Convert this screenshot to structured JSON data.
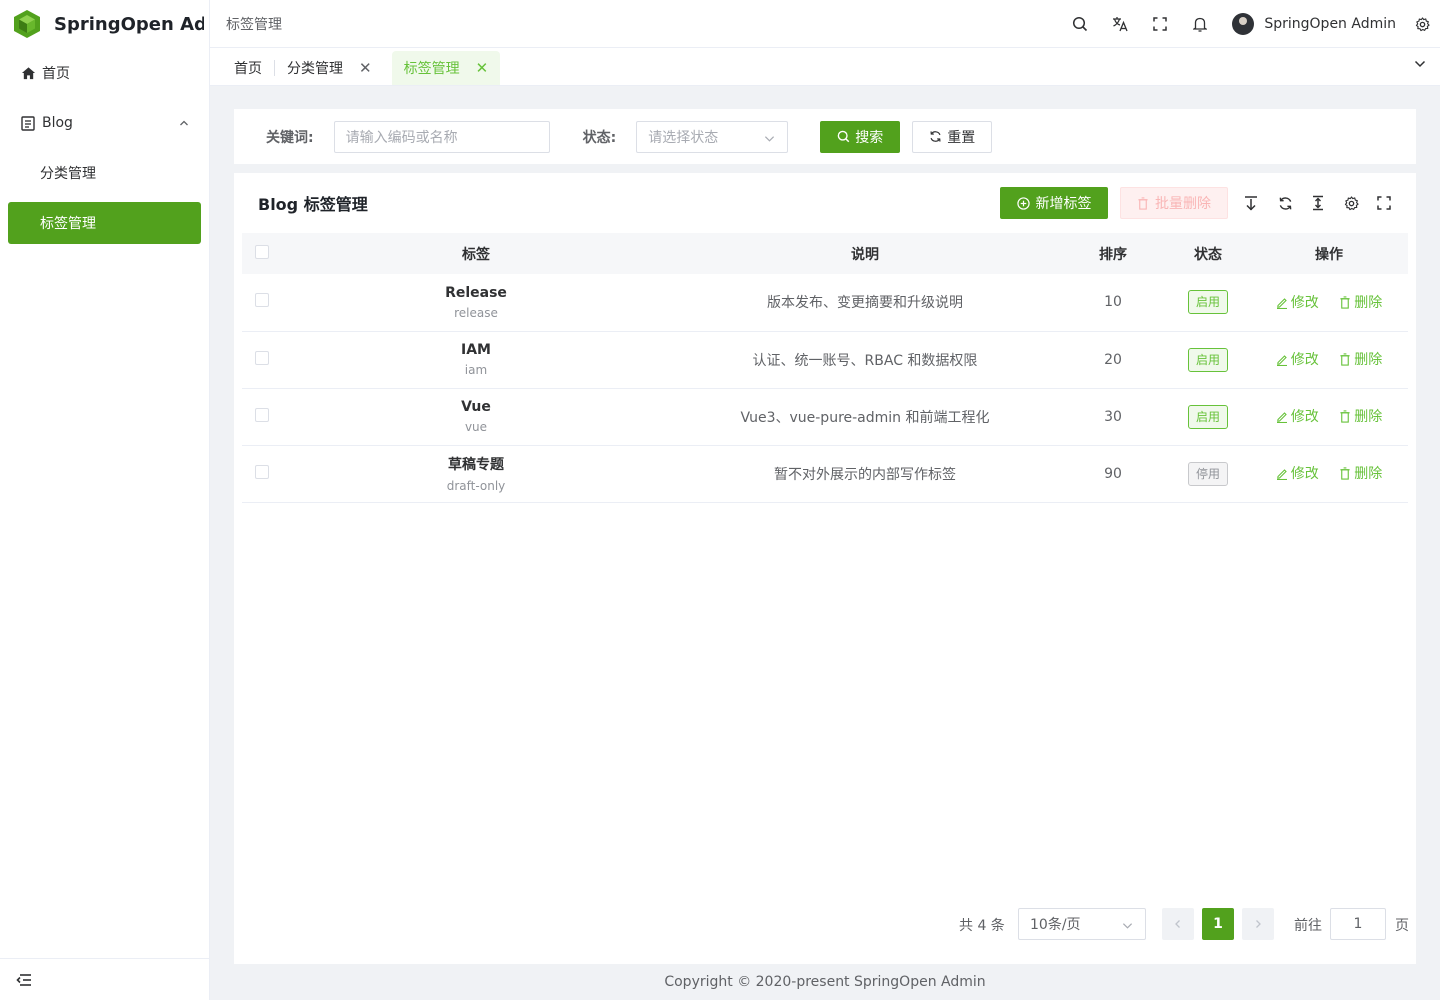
{
  "app": {
    "title": "SpringOpen Ad..."
  },
  "sidebar": {
    "home": "首页",
    "blog": "Blog",
    "sub_items": [
      "分类管理",
      "标签管理"
    ]
  },
  "navbar": {
    "breadcrumb": "标签管理",
    "user_name": "SpringOpen Admin"
  },
  "tags": [
    {
      "label": "首页"
    },
    {
      "label": "分类管理"
    },
    {
      "label": "标签管理"
    }
  ],
  "search": {
    "keyword_label": "关键词:",
    "keyword_placeholder": "请输入编码或名称",
    "status_label": "状态:",
    "status_placeholder": "请选择状态",
    "search_btn": "搜索",
    "reset_btn": "重置"
  },
  "table_card": {
    "title": "Blog 标签管理",
    "add_btn": "新增标签",
    "batch_delete_btn": "批量删除",
    "columns": [
      "标签",
      "说明",
      "排序",
      "状态",
      "操作"
    ],
    "edit_label": "修改",
    "delete_label": "删除",
    "rows": [
      {
        "name": "Release",
        "code": "release",
        "desc": "版本发布、变更摘要和升级说明",
        "sort": "10",
        "status": "启用"
      },
      {
        "name": "IAM",
        "code": "iam",
        "desc": "认证、统一账号、RBAC 和数据权限",
        "sort": "20",
        "status": "启用"
      },
      {
        "name": "Vue",
        "code": "vue",
        "desc": "Vue3、vue-pure-admin 和前端工程化",
        "sort": "30",
        "status": "启用"
      },
      {
        "name": "草稿专题",
        "code": "draft-only",
        "desc": "暂不对外展示的内部写作标签",
        "sort": "90",
        "status": "停用"
      }
    ]
  },
  "pagination": {
    "total": "共 4 条",
    "page_size": "10条/页",
    "current": "1",
    "goto_label": "前往",
    "goto_value": "1",
    "page_suffix": "页"
  },
  "footer": {
    "copyright": "Copyright © 2020-present SpringOpen Admin"
  },
  "colors": {
    "primary": "#52a11d",
    "success": "#67c23a"
  }
}
